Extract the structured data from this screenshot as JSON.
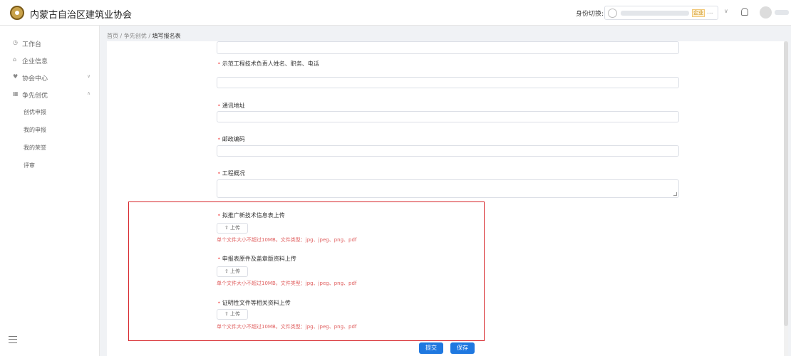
{
  "header": {
    "title": "内蒙古自治区建筑业协会",
    "identity_label": "身份切换:",
    "identity_tag": "企业",
    "identity_placeholder": "..."
  },
  "sidebar": {
    "items": [
      {
        "label": "工作台",
        "icon": "clock-icon"
      },
      {
        "label": "企业信息",
        "icon": "building-icon"
      },
      {
        "label": "协会中心",
        "icon": "heart-icon"
      },
      {
        "label": "争先创优",
        "icon": "grid-icon"
      }
    ],
    "sub_items": [
      "创优申报",
      "我的申报",
      "我的荣誉",
      "评审"
    ]
  },
  "breadcrumb": {
    "home": "首页",
    "sep1": "/",
    "section": "争先创优",
    "sep2": "/",
    "current": "填写报名表"
  },
  "form": {
    "fields": [
      {
        "label": "示范工程技术负责人姓名、职务、电话"
      },
      {
        "label": "通讯地址"
      },
      {
        "label": "邮政编码"
      },
      {
        "label": "工程概况"
      }
    ],
    "uploads": [
      {
        "label": "拟推广新技术信息表上传",
        "button": "上传",
        "hint": "单个文件大小不超过10MB，文件类型：jpg、jpeg、png、pdf"
      },
      {
        "label": "申报表原件及盖章版资料上传",
        "button": "上传",
        "hint": "单个文件大小不超过10MB，文件类型：jpg、jpeg、png、pdf"
      },
      {
        "label": "证明性文件等相关资料上传",
        "button": "上传",
        "hint": "单个文件大小不超过10MB，文件类型：jpg、jpeg、png、pdf"
      }
    ],
    "submit_label": "提交",
    "save_label": "保存"
  },
  "colors": {
    "primary": "#1f78e0",
    "required": "#f56c6c",
    "highlight_box": "#d7262b"
  }
}
